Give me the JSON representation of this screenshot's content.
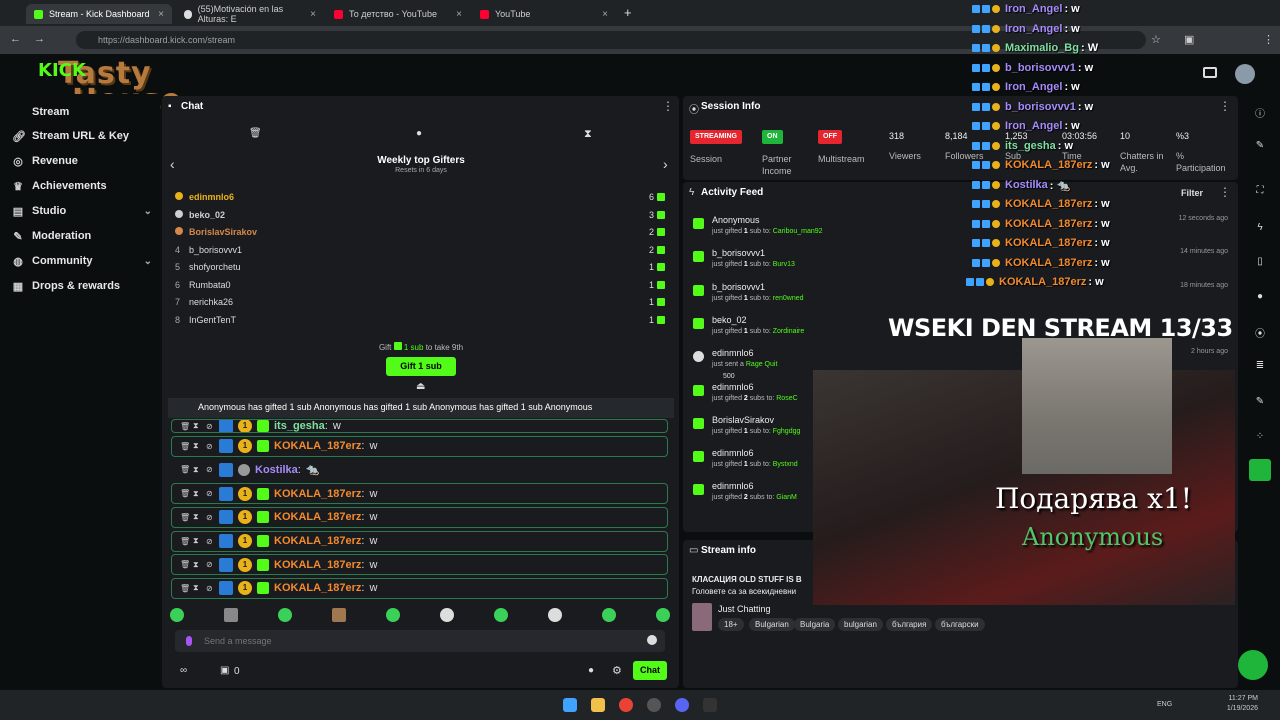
{
  "browser": {
    "tabs": [
      {
        "title": "Stream - Kick Dashboard",
        "close": "×"
      },
      {
        "title": "(55)Motivación en las Alturas: E",
        "close": "×"
      },
      {
        "title": "То детство - YouTube",
        "close": "×"
      },
      {
        "title": "YouTube",
        "close": "×"
      }
    ],
    "new_tab": "+",
    "url": "https://dashboard.kick.com/stream"
  },
  "brand": {
    "line1": "Tasty",
    "line2": "House",
    "kick": "KICK"
  },
  "sidebar": {
    "items": [
      {
        "label": "Stream"
      },
      {
        "label": "Stream URL & Key"
      },
      {
        "label": "Revenue"
      },
      {
        "label": "Achievements"
      },
      {
        "label": "Studio"
      },
      {
        "label": "Moderation"
      },
      {
        "label": "Community"
      },
      {
        "label": "Drops & rewards"
      }
    ]
  },
  "chat": {
    "title": "Chat",
    "gifters_title": "Weekly top Gifters",
    "gifters_sub": "Resets in 6 days",
    "gifters": [
      {
        "rank": "",
        "name": "edinmnlo6",
        "count": "6"
      },
      {
        "rank": "",
        "name": "beko_02",
        "count": "3"
      },
      {
        "rank": "",
        "name": "BorislavSirakov",
        "count": "2"
      },
      {
        "rank": "4",
        "name": "b_borisovvv1",
        "count": "2"
      },
      {
        "rank": "5",
        "name": "shofyorchetu",
        "count": "1"
      },
      {
        "rank": "6",
        "name": "Rumbata0",
        "count": "1"
      },
      {
        "rank": "7",
        "name": "nerichka26",
        "count": "1"
      },
      {
        "rank": "8",
        "name": "InGentTenT",
        "count": "1"
      }
    ],
    "gift_hint_pre": "Gift",
    "gift_hint_mid": "1 sub",
    "gift_hint_post": "to take 9th",
    "gift_button": "Gift 1 sub",
    "ticker": "Anonymous has gifted 1 sub   Anonymous has gifted 1 sub   Anonymous has gifted 1 sub   Anonymous",
    "messages": [
      {
        "user": "its_gesha",
        "text": "w",
        "color": "#7ee0a0"
      },
      {
        "user": "KOKALA_187erz",
        "text": "w",
        "color": "#f28a2e"
      },
      {
        "user": "Kostilka",
        "text": "🐀",
        "color": "#a78bfa"
      },
      {
        "user": "KOKALA_187erz",
        "text": "w",
        "color": "#f28a2e"
      },
      {
        "user": "KOKALA_187erz",
        "text": "w",
        "color": "#f28a2e"
      },
      {
        "user": "KOKALA_187erz",
        "text": "w",
        "color": "#f28a2e"
      },
      {
        "user": "KOKALA_187erz",
        "text": "w",
        "color": "#f28a2e"
      },
      {
        "user": "KOKALA_187erz",
        "text": "w",
        "color": "#f28a2e"
      }
    ],
    "input_placeholder": "Send a message",
    "footer_count": "0",
    "send_label": "Chat"
  },
  "session": {
    "title": "Session Info",
    "status": [
      {
        "pill": "STREAMING",
        "color": "#e5262f",
        "label": "Session"
      },
      {
        "pill": "ON",
        "color": "#1fb53a",
        "label": "Partner Income"
      },
      {
        "pill": "OFF",
        "color": "#e5262f",
        "label": "Multistream"
      }
    ],
    "stats": [
      {
        "value": "318",
        "label": "Viewers"
      },
      {
        "value": "8,184",
        "label": "Followers"
      },
      {
        "value": "1,253",
        "label": "Sub"
      },
      {
        "value": "03:03:56",
        "label": "Time"
      },
      {
        "value": "10",
        "label": "Chatters in Avg."
      },
      {
        "value": "%3",
        "label": "% Participation"
      }
    ]
  },
  "activity": {
    "title": "Activity Feed",
    "filter": "Filter",
    "items": [
      {
        "name": "Anonymous",
        "desc": "just gifted",
        "qty": "1",
        "desc2": "sub to:",
        "target": "Caribou_man92",
        "ago": "12 seconds ago"
      },
      {
        "name": "b_borisovvv1",
        "desc": "just gifted",
        "qty": "1",
        "desc2": "sub to:",
        "target": "Burv13",
        "ago": "14 minutes ago"
      },
      {
        "name": "b_borisovvv1",
        "desc": "just gifted",
        "qty": "1",
        "desc2": "sub to:",
        "target": "ren0wned",
        "ago": "18 minutes ago"
      },
      {
        "name": "beko_02",
        "desc": "just gifted",
        "qty": "1",
        "desc2": "sub to:",
        "target": "Zordinaire",
        "ago": ""
      },
      {
        "name": "edinmnlo6",
        "desc": "just sent a",
        "qty": "",
        "desc2": "",
        "target": "Rage Quit",
        "ago": "2 hours ago",
        "amount": "500"
      },
      {
        "name": "edinmnlo6",
        "desc": "just gifted",
        "qty": "2",
        "desc2": "subs to:",
        "target": "RoseC",
        "ago": ""
      },
      {
        "name": "BorislavSirakov",
        "desc": "just gifted",
        "qty": "1",
        "desc2": "sub to:",
        "target": "Fghgdgg",
        "ago": ""
      },
      {
        "name": "edinmnlo6",
        "desc": "just gifted",
        "qty": "1",
        "desc2": "sub to:",
        "target": "Bystxnd",
        "ago": ""
      },
      {
        "name": "edinmnlo6",
        "desc": "just gifted",
        "qty": "2",
        "desc2": "subs to:",
        "target": "GianM",
        "ago": ""
      }
    ]
  },
  "stream_info": {
    "title": "Stream info",
    "stream_title_line1": "КЛАСАЦИЯ OLD STUFF IS B",
    "stream_title_line2": "Головете са за всекидневни",
    "category": "Just Chatting",
    "tags": [
      "18+",
      "Bulgarian",
      "Bulgaria",
      "bulgarian",
      "българия",
      "български"
    ]
  },
  "overlay": {
    "chat": [
      {
        "user": "Iron_Angel",
        "text": ": w",
        "color": "#a78bfa"
      },
      {
        "user": "Iron_Angel",
        "text": ": w",
        "color": "#a78bfa"
      },
      {
        "user": "Maximalio_Bg",
        "text": ": W",
        "color": "#7ee0a0"
      },
      {
        "user": "b_borisovvv1",
        "text": ": w",
        "color": "#a78bfa"
      },
      {
        "user": "Iron_Angel",
        "text": ": w",
        "color": "#a78bfa"
      },
      {
        "user": "b_borisovvv1",
        "text": ": w",
        "color": "#a78bfa"
      },
      {
        "user": "Iron_Angel",
        "text": ": w",
        "color": "#a78bfa"
      },
      {
        "user": "its_gesha",
        "text": ": w",
        "color": "#7ee0a0"
      },
      {
        "user": "KOKALA_187erz",
        "text": ": w",
        "color": "#f28a2e"
      },
      {
        "user": "Kostilka",
        "text": ": 🐀",
        "color": "#a78bfa"
      },
      {
        "user": "KOKALA_187erz",
        "text": ": w",
        "color": "#f28a2e"
      },
      {
        "user": "KOKALA_187erz",
        "text": ": w",
        "color": "#f28a2e"
      },
      {
        "user": "KOKALA_187erz",
        "text": ": w",
        "color": "#f28a2e"
      },
      {
        "user": "KOKALA_187erz",
        "text": ": w",
        "color": "#f28a2e"
      },
      {
        "user": "KOKALA_187erz",
        "text": ": w",
        "color": "#f28a2e"
      }
    ],
    "stream_title": "WSEKI DEN STREAM 13/33",
    "gift_text": "Подарява х1!",
    "gift_user": "Anonymous"
  },
  "taskbar": {
    "lang": "ENG",
    "time": "11:27 PM",
    "date": "1/19/2026"
  },
  "colors": {
    "accent": "#53fc18",
    "panel": "#191b1f",
    "bg": "#0b0e0f"
  }
}
